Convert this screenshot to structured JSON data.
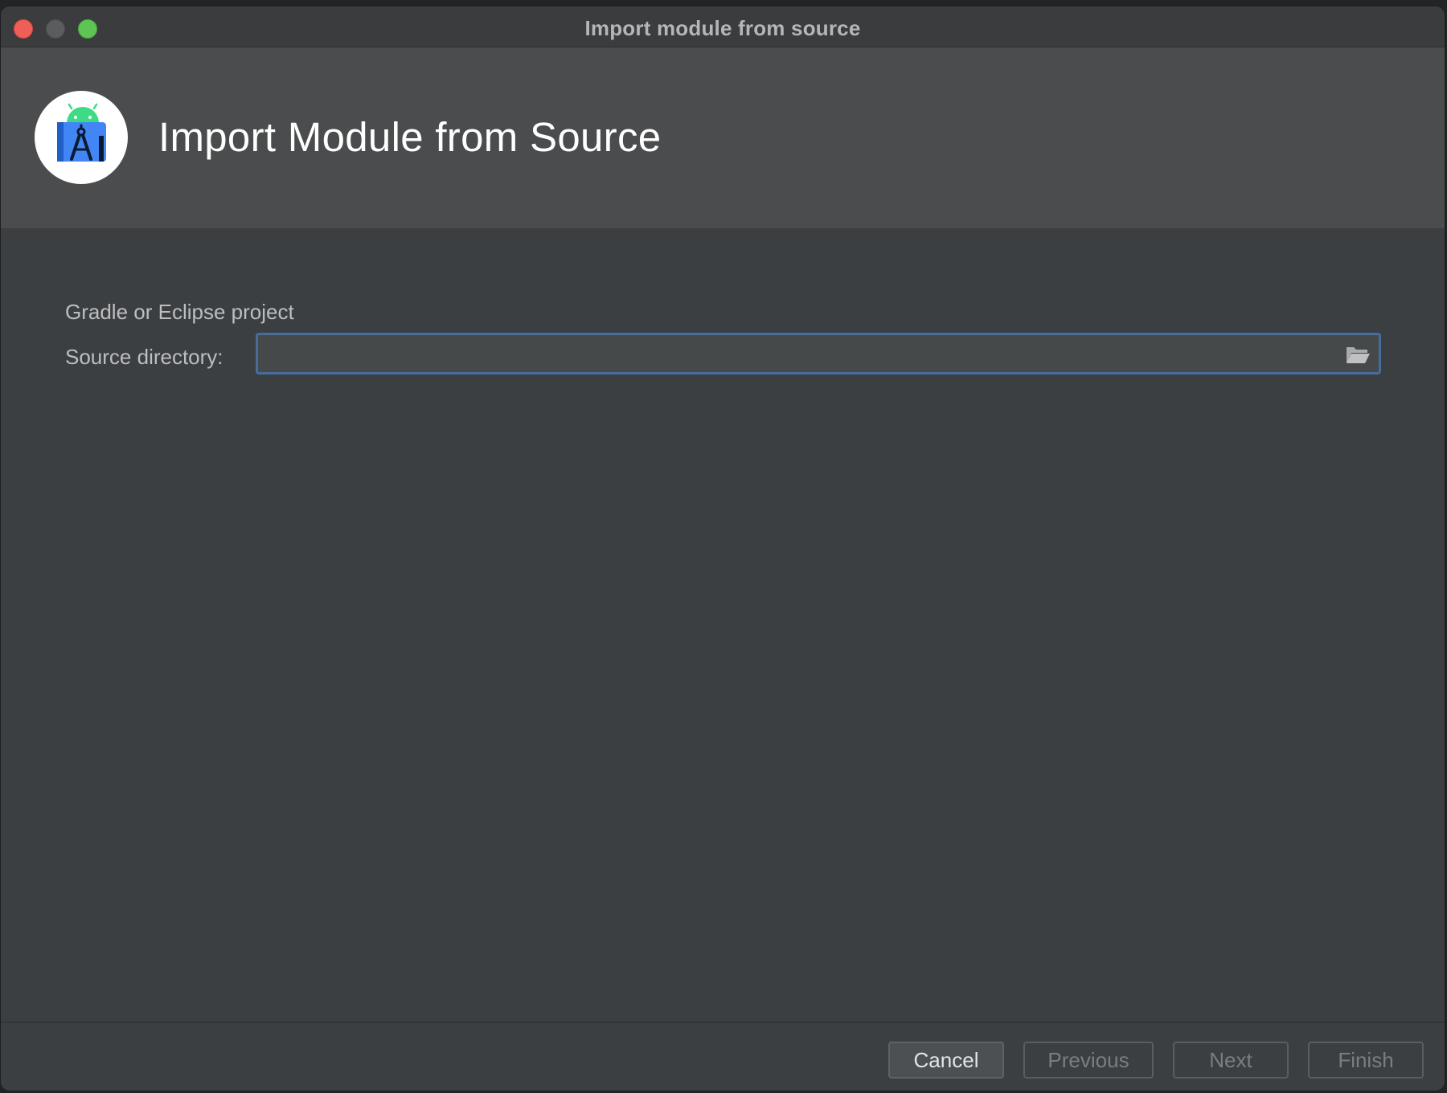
{
  "window": {
    "title": "Import module from source"
  },
  "header": {
    "heading": "Import Module from Source",
    "logo_icon": "android-studio-logo-icon"
  },
  "form": {
    "section_label": "Gradle or Eclipse project",
    "source_directory_label": "Source directory:",
    "source_directory_value": "",
    "browse_icon": "folder-open-icon"
  },
  "footer": {
    "cancel_label": "Cancel",
    "previous_label": "Previous",
    "next_label": "Next",
    "finish_label": "Finish"
  },
  "colors": {
    "window_bg": "#3c3f41",
    "banner_bg": "#4b4c4d",
    "focus_border": "#466d9c",
    "close": "#ee5f57",
    "zoom": "#5ec454",
    "logo_blue": "#4285f4",
    "android_green": "#3ddc84"
  }
}
